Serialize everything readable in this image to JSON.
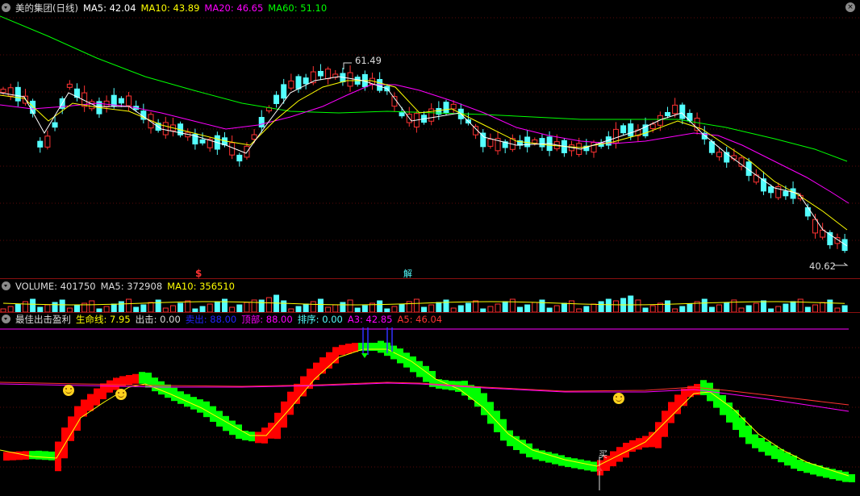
{
  "price_pane": {
    "title": "美的集团(日线)",
    "ma5_label": "MA5: 42.04",
    "ma10_label": "MA10: 43.89",
    "ma20_label": "MA20: 46.65",
    "ma60_label": "MA60: 51.10",
    "high_label": "61.49",
    "low_label": "40.62",
    "colors": {
      "ma5": "#ffffff",
      "ma10": "#ffff00",
      "ma20": "#ff00ff",
      "ma60": "#00ff00",
      "up": "#ff3232",
      "down": "#54ffff"
    },
    "markers": [
      {
        "text": "$",
        "color": "#ff3232"
      },
      {
        "text": "解",
        "color": "#54ffff"
      }
    ]
  },
  "volume_pane": {
    "volume_label": "VOLUME: 401750",
    "ma5_label": "MA5: 372908",
    "ma10_label": "MA10: 356510"
  },
  "indicator_pane": {
    "name": "最佳出击盈利",
    "lifeline_label": "生命线: 7.95",
    "attack_label": "出击: 0.00",
    "sell_label": "卖出: 88.00",
    "top_label": "顶部: 88.00",
    "rank_label": "排序: 0.00",
    "a3_label": "A3: 42.85",
    "a5_label": "A5: 46.04",
    "buy_label": "买",
    "smiley_icons": [
      "smiley-icon",
      "smiley-icon",
      "smiley-icon"
    ]
  },
  "icons": {
    "collapse": "chevron-down-circle-icon",
    "close": "close-icon"
  }
}
